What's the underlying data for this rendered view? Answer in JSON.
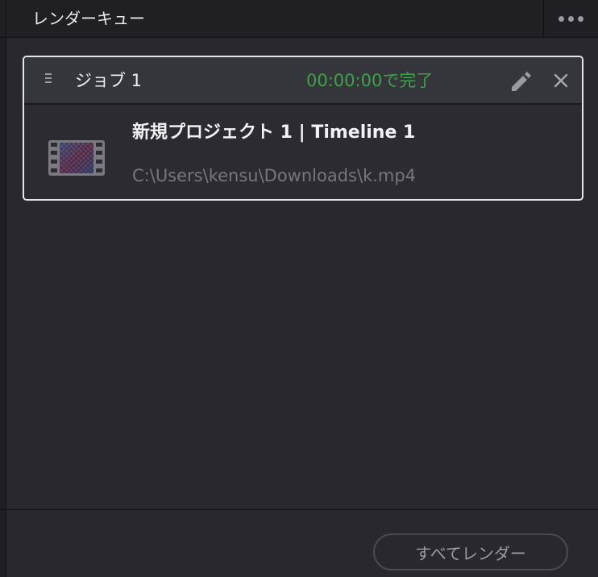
{
  "panel": {
    "title": "レンダーキュー",
    "more_icon": "more-horizontal-icon"
  },
  "job": {
    "title": "ジョブ 1",
    "status": "00:00:00で完了",
    "status_color": "#3fa14a",
    "name": "新規プロジェクト 1 | Timeline 1",
    "path": "C:\\Users\\kensu\\Downloads\\k.mp4",
    "icons": {
      "drag": "drag-handle-icon",
      "edit": "pencil-icon",
      "close": "close-icon",
      "thumbnail": "film-clip-icon"
    }
  },
  "footer": {
    "render_all_label": "すべてレンダー"
  },
  "colors": {
    "background": "#28282e",
    "header_background": "#1f1f24",
    "card_border": "#e6e6e8",
    "card_header": "#35353c"
  }
}
